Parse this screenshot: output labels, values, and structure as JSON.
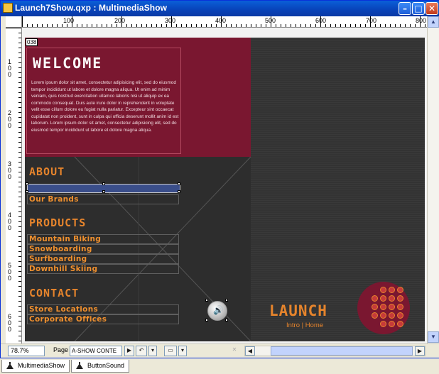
{
  "window": {
    "title": "Launch7Show.qxp : MultimediaShow",
    "controls": {
      "minimize": "–",
      "maximize": "□",
      "close": "✕"
    }
  },
  "rulers": {
    "horizontal_labels": [
      "100",
      "200",
      "300",
      "400",
      "500",
      "600",
      "700",
      "800"
    ],
    "vertical_labels": [
      "100",
      "200",
      "300",
      "400",
      "500",
      "600"
    ]
  },
  "stage": {
    "object_badge": "038",
    "welcome": {
      "title": "WELCOME",
      "body": "Lorem ipsum dolor sit amet, consectetur adipisicing elit, sed do eiusmod tempor incididunt ut labore et dolore magna aliqua. Ut enim ad minim veniam, quis nostrud exercitation ullamco laboris nisi ut aliquip ex ea commodo consequat. Duis aute irure dolor in reprehenderit in voluptate velit esse cillum dolore eu fugiat nulla pariatur. Excepteur sint occaecat cupidatat non proident, sunt in culpa qui officia deserunt mollit anim id est laborum. Lorem ipsum dolor sit amet, consectetur adipisicing elit, sed do eiusmod tempor incididunt ut labore et dolore magna aliqua."
    },
    "about": {
      "title": "ABOUT",
      "links": [
        "Our Brands"
      ]
    },
    "products": {
      "title": "PRODUCTS",
      "links": [
        "Mountain Biking",
        "Snowboarding",
        "Surfboarding",
        "Downhill Skiing"
      ]
    },
    "contact": {
      "title": "CONTACT",
      "links": [
        "Store Locations",
        "Corporate Offices"
      ]
    },
    "sound_icon": "🔊",
    "launch": {
      "logo": "LAUNCH",
      "links": "Intro | Home"
    },
    "colors": {
      "accent": "#e6842c",
      "maroon": "#7a1730",
      "dark": "#2d2d2d"
    }
  },
  "statusbar": {
    "zoom": "78.7%",
    "page_label": "Page",
    "page_value": "A-SHOW CONTE",
    "nav_next": "▶",
    "nav_prev": "◀"
  },
  "tabs": [
    {
      "label": "MultimediaShow",
      "icon": "layout-icon"
    },
    {
      "label": "ButtonSound",
      "icon": "layout-icon"
    }
  ]
}
